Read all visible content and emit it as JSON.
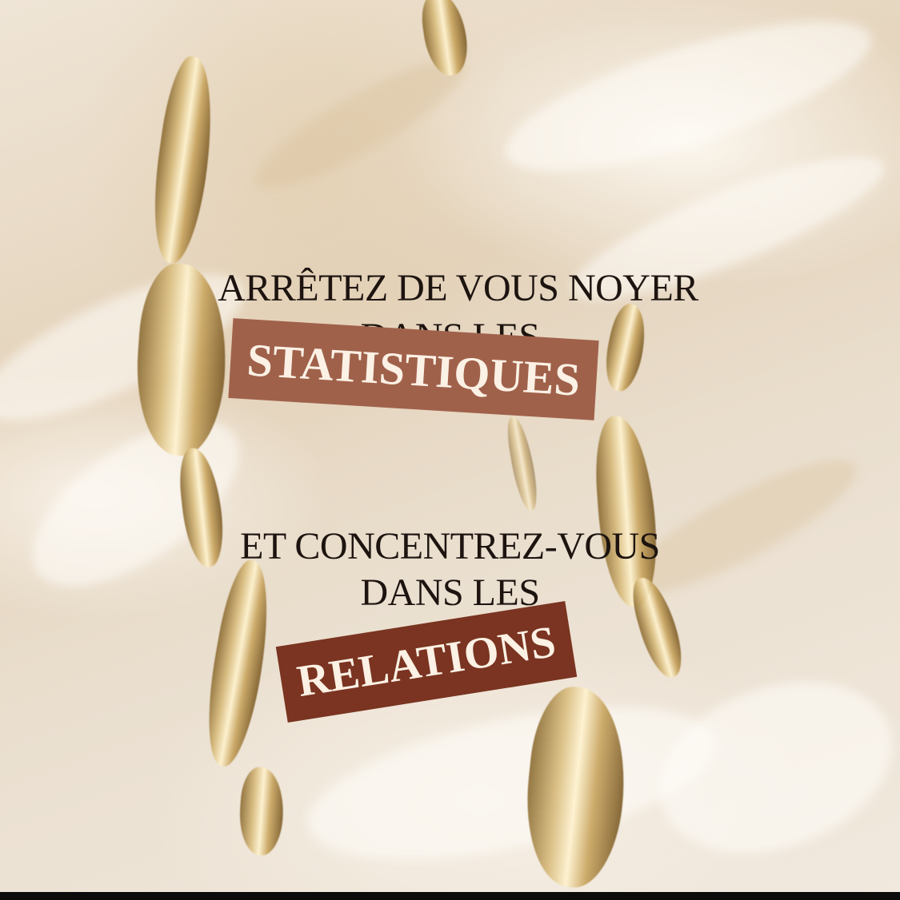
{
  "headline": {
    "line1": "ARRÊTEZ DE VOUS NOYER",
    "line2": "DANS LES",
    "highlight1": "STATISTIQUES",
    "line3": "ET CONCENTREZ-VOUS",
    "line4": "DANS LES",
    "highlight2": "RELATIONS"
  },
  "colors": {
    "highlight1_bg": "#a0614b",
    "highlight2_bg": "#7a3421",
    "text": "#1d1410",
    "highlight_text": "#fbf1e4",
    "gold_leaf": "#d8bb7c"
  }
}
